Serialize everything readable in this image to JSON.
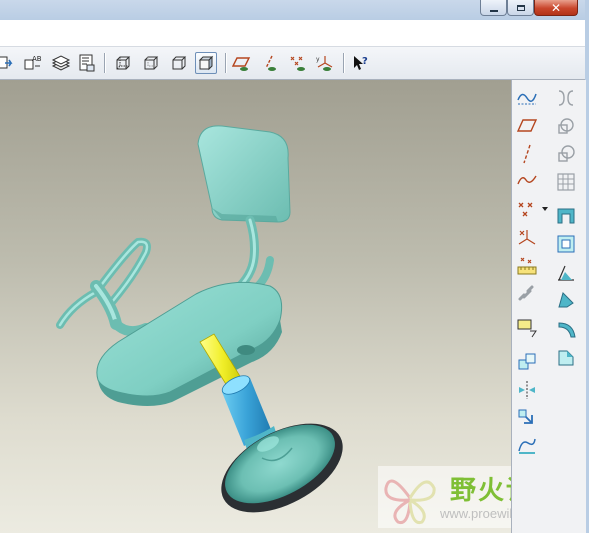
{
  "window": {
    "minimize_label": "minimize",
    "maximize_label": "maximize",
    "close_label": "✕"
  },
  "toolbar": {
    "buttons": [
      {
        "name": "regenerate-icon"
      },
      {
        "name": "dimension-ab-icon"
      },
      {
        "name": "layers-icon"
      },
      {
        "name": "model-tree-icon"
      },
      {
        "name": "wireframe-view-icon"
      },
      {
        "name": "hidden-line-view-icon"
      },
      {
        "name": "no-hidden-view-icon"
      },
      {
        "name": "shaded-view-icon",
        "active": true
      },
      {
        "name": "plane-display-icon"
      },
      {
        "name": "axis-display-icon"
      },
      {
        "name": "point-display-icon"
      },
      {
        "name": "csys-display-icon"
      },
      {
        "name": "context-help-icon"
      }
    ]
  },
  "right_panel": {
    "left_column": [
      "sketch-datum-curve-icon",
      "datum-plane-icon",
      "datum-axis-icon",
      "datum-curve-icon",
      "datum-point-icon",
      "datum-csys-icon",
      "analysis-feature-icon",
      "chain-icon",
      "annotation-note-icon",
      "copy-icon",
      "mirror-icon",
      "move-icon",
      "warp-icon"
    ],
    "right_column": [
      "sketched-feature-icon",
      "extrude-icon",
      "revolve-icon",
      "boolean-cut-icon",
      "shell-icon",
      "hole-icon",
      "draft-icon",
      "rib-icon",
      "round-icon",
      "chamfer-icon"
    ]
  },
  "watermark": {
    "title": "野火论坛",
    "url": "www.proewildfire.cn"
  },
  "colors": {
    "model_body": "#7fcfc3",
    "model_shadow": "#4f9e94",
    "shaft_yellow": "#f0ee28",
    "hub_blue": "#3aa3d8",
    "base_ring": "#2b2f33",
    "viewport_top": "#a19f91",
    "viewport_bottom": "#ecebe1"
  }
}
